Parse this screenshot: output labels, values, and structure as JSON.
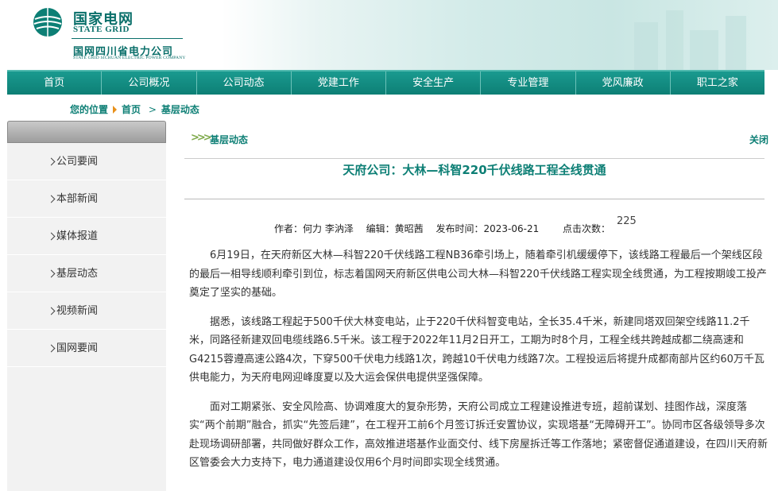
{
  "header": {
    "logo_cn": "国家电网",
    "logo_en": "STATE GRID",
    "company_cn": "国网四川省电力公司",
    "company_en": "STATE GRID SICHUAN ELECTRIC POWER COMPANY"
  },
  "nav": [
    "首页",
    "公司概况",
    "公司动态",
    "党建工作",
    "安全生产",
    "专业管理",
    "党风廉政",
    "职工之家"
  ],
  "breadcrumb": {
    "label": "您的位置",
    "home": "首页",
    "current": "基层动态"
  },
  "sidebar": [
    "公司要闻",
    "本部新闻",
    "媒体报道",
    "基层动态",
    "视频新闻",
    "国网要闻"
  ],
  "section": {
    "title": "基层动态",
    "close": "关闭"
  },
  "article": {
    "title": "天府公司：大林—科智220千伏线路工程全线贯通",
    "author": "作者：何力 李汭泽",
    "editor": "编辑：黄昭茜",
    "date": "发布时间：2023-06-21",
    "hits_label": "点击次数：",
    "hits": "225",
    "paragraphs": [
      "6月19日，在天府新区大林—科智220千伏线路工程NB36牵引场上，随着牵引机缓缓停下，该线路工程最后一个架线区段的最后一相导线顺利牵引到位，标志着国网天府新区供电公司大林—科智220千伏线路工程实现全线贯通，为工程按期竣工投产奠定了坚实的基础。",
      "据悉，该线路工程起于500千伏大林变电站，止于220千伏科智变电站，全长35.4千米，新建同塔双回架空线路11.2千米，同路径新建双回电缆线路6.5千米。该工程于2022年11月2日开工，工期为时8个月，工程全线共跨越成都二绕高速和G4215蓉遵高速公路4次，下穿500千伏电力线路1次，跨越10千伏电力线路7次。工程投运后将提升成都南部片区约60万千瓦供电能力，为天府电网迎峰度夏以及大运会保供电提供坚强保障。",
      "面对工期紧张、安全风险高、协调难度大的复杂形势，天府公司成立工程建设推进专班，超前谋划、挂图作战，深度落实“两个前期”融合，抓实“先签后建”，在工程开工前6个月签订拆迁安置协议，实现塔基“无障碍开工”。协同市区各级领导多次赴现场调研部署，共同做好群众工作，高效推进塔基作业面交付、线下房屋拆迁等工作落地；紧密督促通道建设，在四川天府新区管委会大力支持下，电力通道建设仅用6个月时间即实现全线贯通。"
    ]
  },
  "colors": {
    "brand": "#0d7f75",
    "nav_bg": "#1a9a8f",
    "accent": "#e8901a"
  }
}
